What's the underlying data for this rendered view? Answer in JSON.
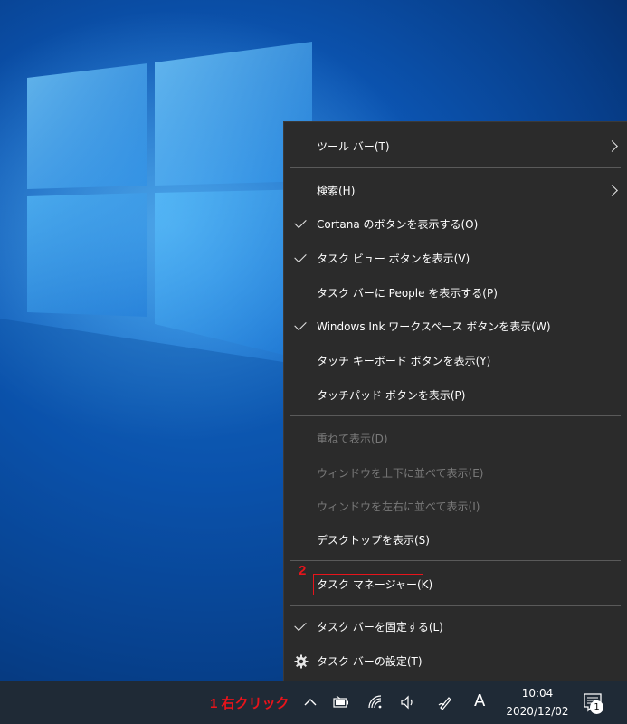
{
  "context_menu": {
    "items": [
      {
        "label": "ツール バー(T)",
        "checked": false,
        "submenu": true,
        "disabled": false
      },
      {
        "label": "検索(H)",
        "checked": false,
        "submenu": true,
        "disabled": false
      },
      {
        "label": "Cortana のボタンを表示する(O)",
        "checked": true,
        "submenu": false,
        "disabled": false
      },
      {
        "label": "タスク ビュー ボタンを表示(V)",
        "checked": true,
        "submenu": false,
        "disabled": false
      },
      {
        "label": "タスク バーに People を表示する(P)",
        "checked": false,
        "submenu": false,
        "disabled": false
      },
      {
        "label": "Windows Ink ワークスペース ボタンを表示(W)",
        "checked": true,
        "submenu": false,
        "disabled": false
      },
      {
        "label": "タッチ キーボード ボタンを表示(Y)",
        "checked": false,
        "submenu": false,
        "disabled": false
      },
      {
        "label": "タッチパッド ボタンを表示(P)",
        "checked": false,
        "submenu": false,
        "disabled": false
      },
      {
        "label": "重ねて表示(D)",
        "checked": false,
        "submenu": false,
        "disabled": true
      },
      {
        "label": "ウィンドウを上下に並べて表示(E)",
        "checked": false,
        "submenu": false,
        "disabled": true
      },
      {
        "label": "ウィンドウを左右に並べて表示(I)",
        "checked": false,
        "submenu": false,
        "disabled": true
      },
      {
        "label": "デスクトップを表示(S)",
        "checked": false,
        "submenu": false,
        "disabled": false
      },
      {
        "label": "タスク マネージャー(K)",
        "checked": false,
        "submenu": false,
        "disabled": false,
        "highlighted": true
      },
      {
        "label": "タスク バーを固定する(L)",
        "checked": true,
        "submenu": false,
        "disabled": false
      },
      {
        "label": "タスク バーの設定(T)",
        "checked": false,
        "submenu": false,
        "disabled": false,
        "icon": "gear-icon"
      }
    ]
  },
  "annotations": {
    "step1": "1 右クリック",
    "step2": "2",
    "color": "#e8141b"
  },
  "taskbar": {
    "clock_time": "10:04",
    "clock_date": "2020/12/02",
    "ime_indicator": "A",
    "notification_count": "1",
    "tray_icons": [
      "chevron-up-icon",
      "battery-icon",
      "wifi-icon",
      "volume-icon",
      "pen-icon"
    ]
  }
}
